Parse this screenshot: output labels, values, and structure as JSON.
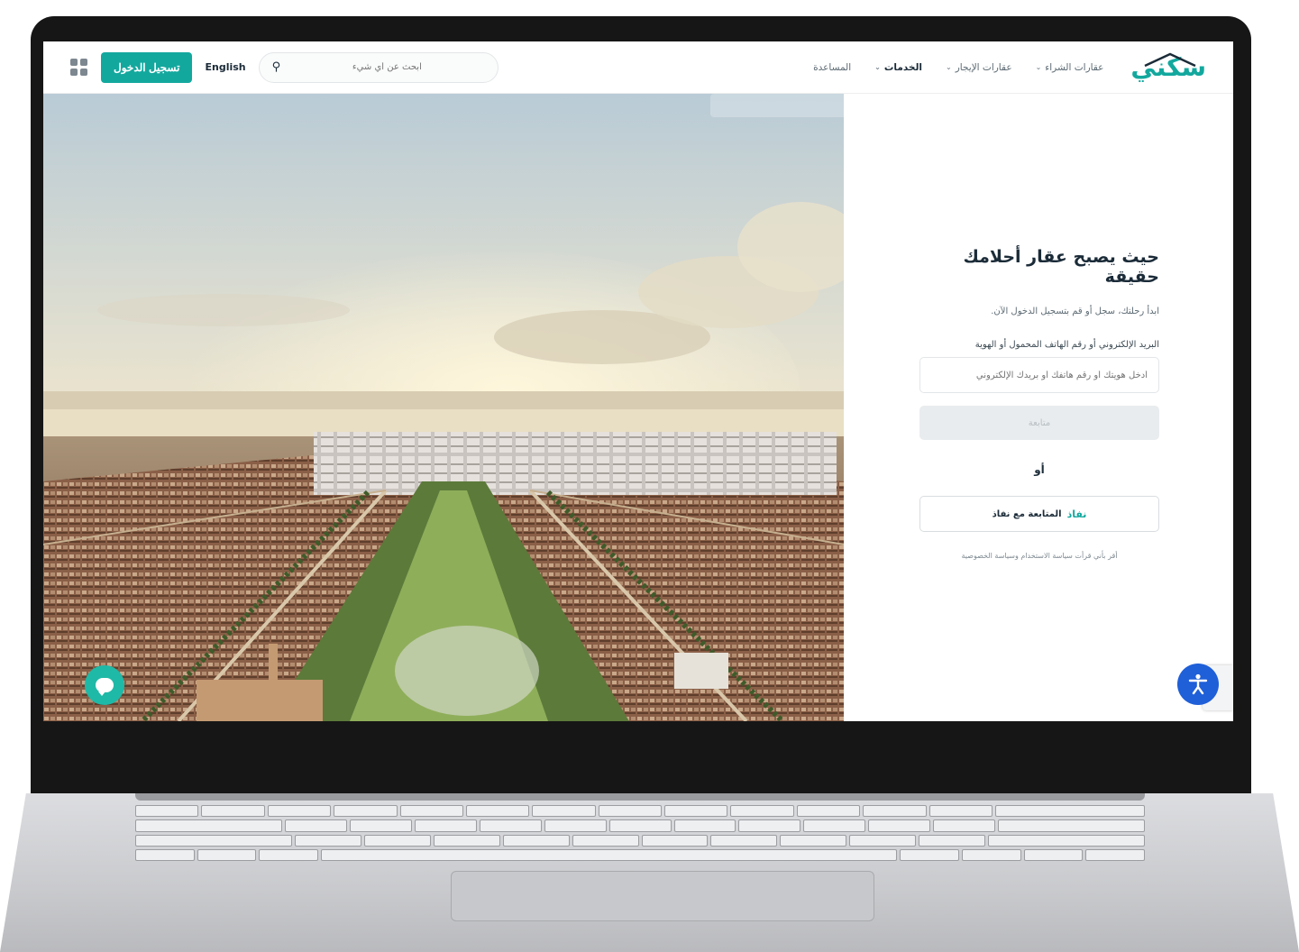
{
  "navbar": {
    "logo_text": "سكني",
    "menu": [
      {
        "label": "عقارات الشراء",
        "has_dropdown": true,
        "active": false
      },
      {
        "label": "عقارات الإيجار",
        "has_dropdown": true,
        "active": false
      },
      {
        "label": "الخدمات",
        "has_dropdown": true,
        "active": true
      },
      {
        "label": "المساعدة",
        "has_dropdown": false,
        "active": false
      }
    ],
    "search_placeholder": "ابحث عن أي شيء",
    "language_label": "English",
    "login_label": "تسجيل الدخول",
    "apps_icon": "grid-icon"
  },
  "login": {
    "heading": "حيث يصبح عقار أحلامك حقيقة",
    "subheading": "ابدأ رحلتك، سجل أو قم بتسجيل الدخول الآن.",
    "field_label": "البريد الإلكتروني أو رقم الهاتف المحمول أو الهوية",
    "field_placeholder": "أدخل هويتك أو رقم هاتفك أو بريدك الإلكتروني",
    "continue_label": "متابعة",
    "or_label": "أو",
    "nafath_logo": "نفاذ",
    "nafath_label": "المتابعة مع نفاذ",
    "footer_note": "أقر بأني قرأت سياسة الاستخدام وسياسة الخصوصية"
  },
  "colors": {
    "brand": "#13a89e",
    "accessibility": "#1f5fd8",
    "chat": "#1fb9a7"
  },
  "floating": {
    "chat_icon": "chat-bubble-icon",
    "accessibility_icon": "accessibility-icon",
    "accessibility_glyph": "🯅"
  }
}
